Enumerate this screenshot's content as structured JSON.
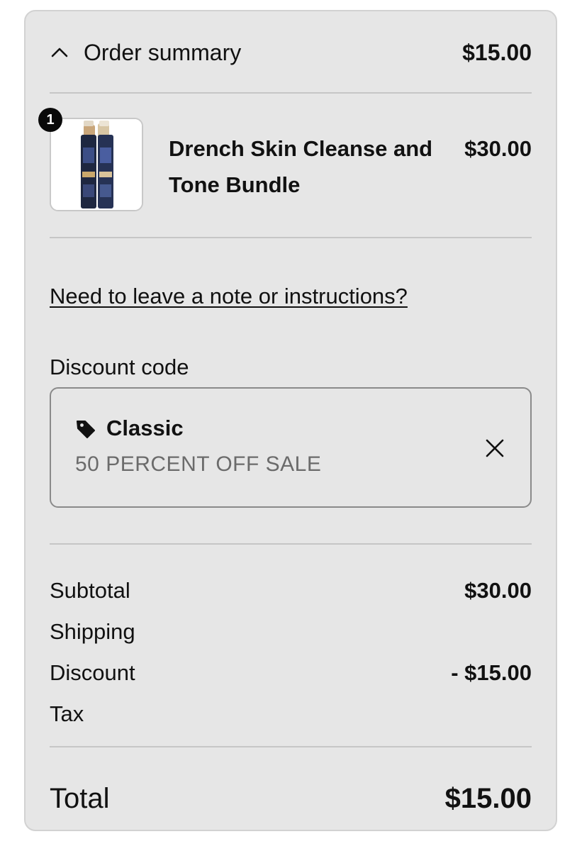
{
  "summary": {
    "title": "Order summary",
    "price": "$15.00"
  },
  "product": {
    "quantity": "1",
    "name": "Drench Skin Cleanse and Tone Bundle",
    "price": "$30.00",
    "thumbnail_icon": "product-bottles"
  },
  "note_link": "Need to leave a note or instructions?",
  "discount": {
    "label": "Discount code",
    "code": "Classic",
    "description": "50 PERCENT OFF SALE"
  },
  "totals": {
    "subtotal_label": "Subtotal",
    "subtotal_value": "$30.00",
    "shipping_label": "Shipping",
    "discount_label": "Discount",
    "discount_value": "- $15.00",
    "tax_label": "Tax",
    "total_label": "Total",
    "total_value": "$15.00"
  },
  "colors": {
    "card_bg": "#e6e6e6",
    "text": "#111111",
    "muted": "#6b6b6b",
    "divider": "#c6c6c6"
  }
}
